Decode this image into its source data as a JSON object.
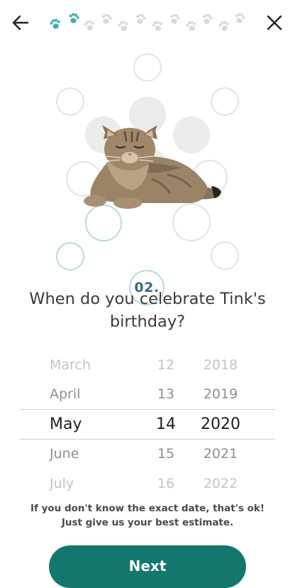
{
  "header": {
    "back_icon": "arrow-left-icon",
    "close_icon": "close-icon",
    "progress": {
      "total_steps": 12,
      "current_step": 2,
      "active_color": "#3fb0a8",
      "inactive_color": "#d9d9d9"
    }
  },
  "hero": {
    "step_label": "02.",
    "image": "tabby-cat-lying-down"
  },
  "question": {
    "text": "When do you celebrate Tink's birthday?"
  },
  "picker": {
    "months": [
      "March",
      "April",
      "May",
      "June",
      "July"
    ],
    "days": [
      "12",
      "13",
      "14",
      "15",
      "16"
    ],
    "years": [
      "2018",
      "2019",
      "2020",
      "2021",
      "2022"
    ],
    "selected": {
      "month": "May",
      "day": "14",
      "year": "2020"
    }
  },
  "hint": {
    "line1": "If you don't know the exact date, that's ok!",
    "line2": "Just give us your best estimate."
  },
  "actions": {
    "next_label": "Next",
    "next_color": "#14776e"
  }
}
